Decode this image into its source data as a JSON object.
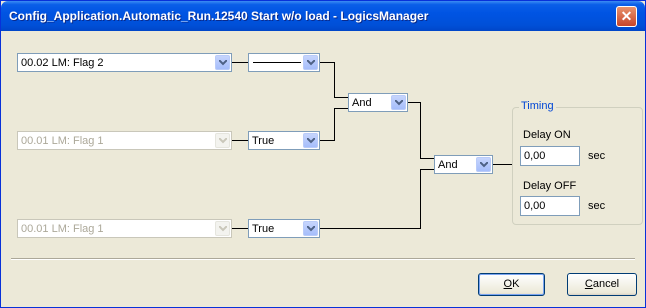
{
  "window": {
    "title": "Config_Application.Automatic_Run.12540 Start w/o load - LogicsManager",
    "close_glyph": "✕"
  },
  "inputs": [
    {
      "value": "00.02 LM: Flag 2",
      "enabled": true
    },
    {
      "value": "00.01 LM: Flag 1",
      "enabled": false
    },
    {
      "value": "00.01 LM: Flag 1",
      "enabled": false
    }
  ],
  "modifiers": [
    {
      "value": "",
      "shows_line": true
    },
    {
      "value": "True"
    },
    {
      "value": "True"
    }
  ],
  "operators": [
    {
      "value": "And"
    },
    {
      "value": "And"
    }
  ],
  "timing": {
    "legend": "Timing",
    "delay_on_label": "Delay ON",
    "delay_on_value": "0,00",
    "delay_on_unit": "sec",
    "delay_off_label": "Delay OFF",
    "delay_off_value": "0,00",
    "delay_off_unit": "sec"
  },
  "buttons": {
    "ok_mnemonic": "O",
    "ok_rest": "K",
    "cancel_mnemonic": "C",
    "cancel_rest": "ancel"
  },
  "colors": {
    "titlebar": "#0054e3",
    "dialog_bg": "#ece9d8",
    "timing_legend": "#0046d5"
  }
}
